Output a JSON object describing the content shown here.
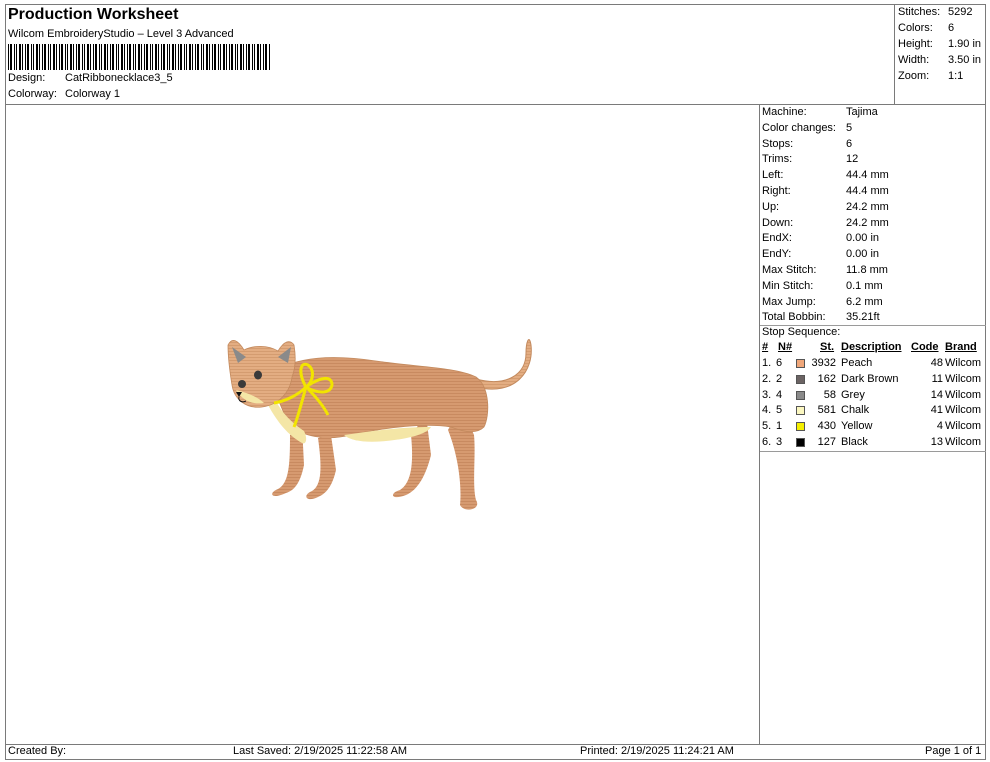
{
  "header": {
    "title": "Production Worksheet",
    "subtitle": "Wilcom EmbroideryStudio – Level 3 Advanced",
    "design_label": "Design:",
    "design_value": "CatRibbonecklace3_5",
    "colorway_label": "Colorway:",
    "colorway_value": "Colorway 1"
  },
  "summary": [
    {
      "label": "Stitches:",
      "value": "5292"
    },
    {
      "label": "Colors:",
      "value": "6"
    },
    {
      "label": "Height:",
      "value": "1.90 in"
    },
    {
      "label": "Width:",
      "value": "3.50 in"
    },
    {
      "label": "Zoom:",
      "value": "1:1"
    }
  ],
  "machine_info": [
    {
      "label": "Machine:",
      "value": "Tajima"
    },
    {
      "label": "Color changes:",
      "value": "5"
    },
    {
      "label": "Stops:",
      "value": "6"
    },
    {
      "label": "Trims:",
      "value": "12"
    },
    {
      "label": "Left:",
      "value": "44.4 mm"
    },
    {
      "label": "Right:",
      "value": "44.4 mm"
    },
    {
      "label": "Up:",
      "value": "24.2 mm"
    },
    {
      "label": "Down:",
      "value": "24.2 mm"
    },
    {
      "label": "EndX:",
      "value": "0.00 in"
    },
    {
      "label": "EndY:",
      "value": "0.00 in"
    },
    {
      "label": "Max Stitch:",
      "value": "11.8 mm"
    },
    {
      "label": "Min Stitch:",
      "value": "0.1 mm"
    },
    {
      "label": "Max Jump:",
      "value": "6.2 mm"
    },
    {
      "label": "Total Bobbin:",
      "value": "35.21ft"
    }
  ],
  "stop_sequence": {
    "title": "Stop Sequence:",
    "columns": {
      "num": "#",
      "needle": "N#",
      "stitches": "St.",
      "description": "Description",
      "code": "Code",
      "brand": "Brand"
    },
    "rows": [
      {
        "num": "1.",
        "needle": "6",
        "color": "#f0a77a",
        "stitches": "3932",
        "description": "Peach",
        "code": "48",
        "brand": "Wilcom"
      },
      {
        "num": "2.",
        "needle": "2",
        "color": "#6b6363",
        "stitches": "162",
        "description": "Dark Brown",
        "code": "11",
        "brand": "Wilcom"
      },
      {
        "num": "3.",
        "needle": "4",
        "color": "#8a8a8a",
        "stitches": "58",
        "description": "Grey",
        "code": "14",
        "brand": "Wilcom"
      },
      {
        "num": "4.",
        "needle": "5",
        "color": "#fbf7c0",
        "stitches": "581",
        "description": "Chalk",
        "code": "41",
        "brand": "Wilcom"
      },
      {
        "num": "5.",
        "needle": "1",
        "color": "#f5f000",
        "stitches": "430",
        "description": "Yellow",
        "code": "4",
        "brand": "Wilcom"
      },
      {
        "num": "6.",
        "needle": "3",
        "color": "#000000",
        "stitches": "127",
        "description": "Black",
        "code": "13",
        "brand": "Wilcom"
      }
    ]
  },
  "footer": {
    "created_by": "Created By:",
    "last_saved": "Last Saved: 2/19/2025 11:22:58 AM",
    "printed": "Printed: 2/19/2025 11:24:21 AM",
    "page": "Page 1 of 1"
  }
}
